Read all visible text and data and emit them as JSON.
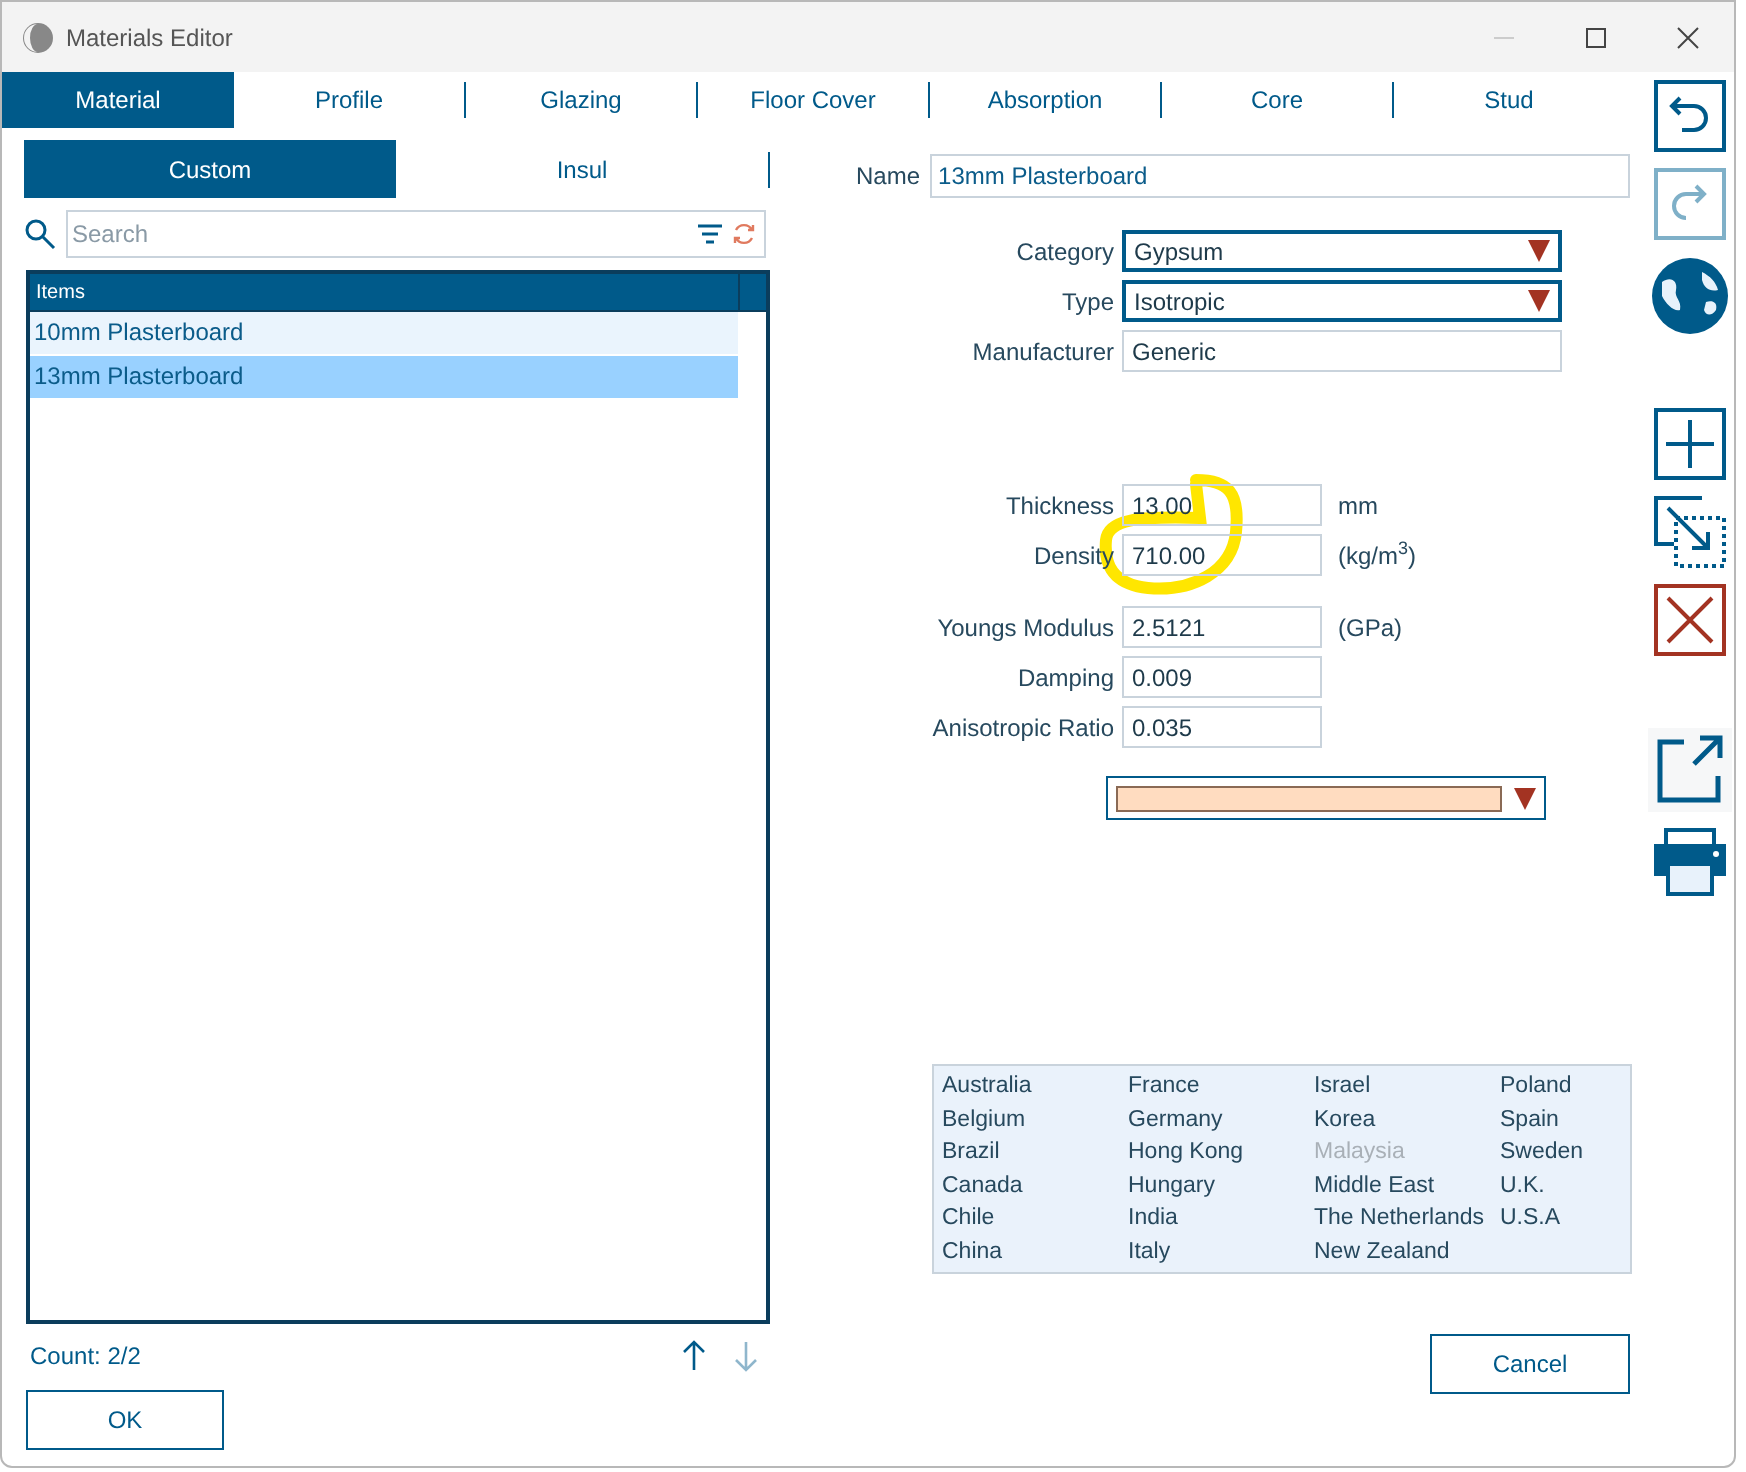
{
  "window": {
    "title": "Materials Editor"
  },
  "tabs": [
    {
      "label": "Material",
      "selected": true
    },
    {
      "label": "Profile",
      "selected": false
    },
    {
      "label": "Glazing",
      "selected": false
    },
    {
      "label": "Floor Cover",
      "selected": false
    },
    {
      "label": "Absorption",
      "selected": false
    },
    {
      "label": "Core",
      "selected": false
    },
    {
      "label": "Stud",
      "selected": false
    }
  ],
  "subtabs": [
    {
      "label": "Custom",
      "selected": true
    },
    {
      "label": "Insul",
      "selected": false
    }
  ],
  "search": {
    "placeholder": "Search"
  },
  "list": {
    "header": "Items",
    "items": [
      {
        "label": "10mm Plasterboard",
        "selected": false
      },
      {
        "label": "13mm Plasterboard",
        "selected": true
      }
    ],
    "count": "Count: 2/2",
    "move_up": {
      "disabled": false
    },
    "move_down": {
      "disabled": true
    }
  },
  "name": {
    "label": "Name",
    "value": "13mm Plasterboard"
  },
  "field_groups": [
    [
      {
        "kind": "dropdown",
        "label": "Category",
        "value": "Gypsum"
      },
      {
        "kind": "dropdown",
        "label": "Type",
        "value": "Isotropic"
      },
      {
        "kind": "text",
        "label": "Manufacturer",
        "value": "Generic"
      }
    ],
    [
      {
        "kind": "number",
        "label": "Thickness",
        "value": "13.00",
        "unit": "mm"
      },
      {
        "kind": "number",
        "label": "Density",
        "value": "710.00",
        "unit": "(kg/m$^{3}$)"
      }
    ],
    [
      {
        "kind": "number",
        "label": "Youngs Modulus",
        "value": "2.5121",
        "unit": "(GPa)"
      },
      {
        "kind": "number",
        "label": "Damping",
        "value": "0.009"
      },
      {
        "kind": "number",
        "label": "Anisotropic Ratio",
        "value": "0.035"
      }
    ]
  ],
  "color_dropdown": {
    "color": "#ffdcc0"
  },
  "countries": [
    {
      "label": "Australia",
      "disabled": false
    },
    {
      "label": "Belgium",
      "disabled": false
    },
    {
      "label": "Brazil",
      "disabled": false
    },
    {
      "label": "Canada",
      "disabled": false
    },
    {
      "label": "Chile",
      "disabled": false
    },
    {
      "label": "China",
      "disabled": false
    },
    {
      "label": "France",
      "disabled": false
    },
    {
      "label": "Germany",
      "disabled": false
    },
    {
      "label": "Hong Kong",
      "disabled": false
    },
    {
      "label": "Hungary",
      "disabled": false
    },
    {
      "label": "India",
      "disabled": false
    },
    {
      "label": "Italy",
      "disabled": false
    },
    {
      "label": "Israel",
      "disabled": false
    },
    {
      "label": "Korea",
      "disabled": false
    },
    {
      "label": "Malaysia",
      "disabled": true
    },
    {
      "label": "Middle East",
      "disabled": false
    },
    {
      "label": "The Netherlands",
      "disabled": false
    },
    {
      "label": "New Zealand",
      "disabled": false
    },
    {
      "label": "Poland",
      "disabled": false
    },
    {
      "label": "Spain",
      "disabled": false
    },
    {
      "label": "Sweden",
      "disabled": false
    },
    {
      "label": "U.K.",
      "disabled": false
    },
    {
      "label": "U.S.A",
      "disabled": false
    }
  ],
  "toolbar": [
    {
      "kind": "undo",
      "disabled": false
    },
    {
      "kind": "redo",
      "disabled": true
    },
    {
      "kind": "globe",
      "disabled": false
    },
    {
      "kind": "add",
      "disabled": false
    },
    {
      "kind": "copy",
      "disabled": false
    },
    {
      "kind": "delete",
      "disabled": false
    },
    {
      "kind": "export",
      "disabled": false
    },
    {
      "kind": "print",
      "disabled": false
    }
  ],
  "buttons": {
    "ok": "OK",
    "cancel": "Cancel"
  }
}
